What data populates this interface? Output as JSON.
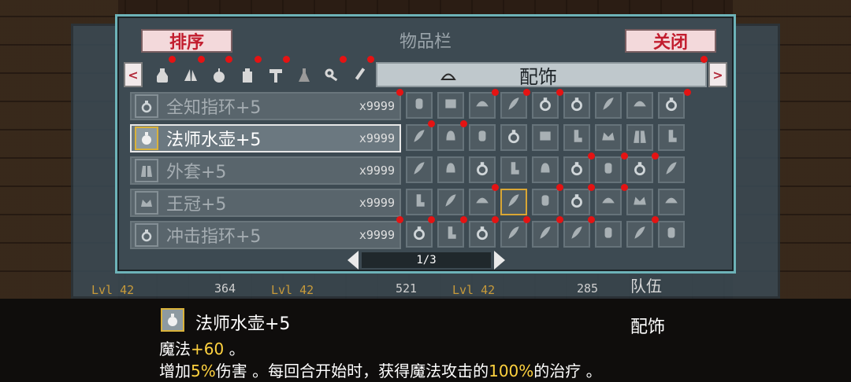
{
  "header": {
    "title": "物品栏",
    "sort_label": "排序",
    "close_label": "关闭"
  },
  "tabs": {
    "prev_arrow": "<",
    "next_arrow": ">",
    "active_label": "配饰",
    "category_icons": [
      "potion-icon",
      "wing-icon",
      "fruit-icon",
      "bottle-icon",
      "hammer-icon",
      "flask-icon",
      "key-icon",
      "brush-icon"
    ]
  },
  "items": [
    {
      "name": "全知指环+5",
      "count": "x9999",
      "icon": "ring-icon",
      "selected": false
    },
    {
      "name": "法师水壶+5",
      "count": "x9999",
      "icon": "kettle-icon",
      "selected": true
    },
    {
      "name": "外套+5",
      "count": "x9999",
      "icon": "coat-icon",
      "selected": false
    },
    {
      "name": "王冠+5",
      "count": "x9999",
      "icon": "crown-icon",
      "selected": false
    },
    {
      "name": "冲击指环+5",
      "count": "x9999",
      "icon": "ring-icon",
      "selected": false
    }
  ],
  "pager": {
    "label": "1/3"
  },
  "background": {
    "stats": [
      "364",
      "521",
      "285"
    ],
    "levels": [
      "Lvl 42",
      "Lvl 42",
      "Lvl 42"
    ],
    "team_label": "队伍"
  },
  "detail": {
    "name": "法师水壶+5",
    "category": "配饰",
    "line1_prefix": "魔法",
    "line1_value": "+60",
    "line1_suffix": " 。",
    "line2_a": "增加",
    "line2_pct1": "5%",
    "line2_b": "伤害 。每回合开始时，获得魔法攻击的",
    "line2_pct2": "100%",
    "line2_c": "的治疗 。"
  },
  "colors": {
    "accent_teal": "#6db3b8",
    "button_pink": "#f3d9db",
    "button_text_red": "#c21d2e",
    "highlight_yellow": "#ffd23f",
    "new_badge_red": "#e51313"
  }
}
